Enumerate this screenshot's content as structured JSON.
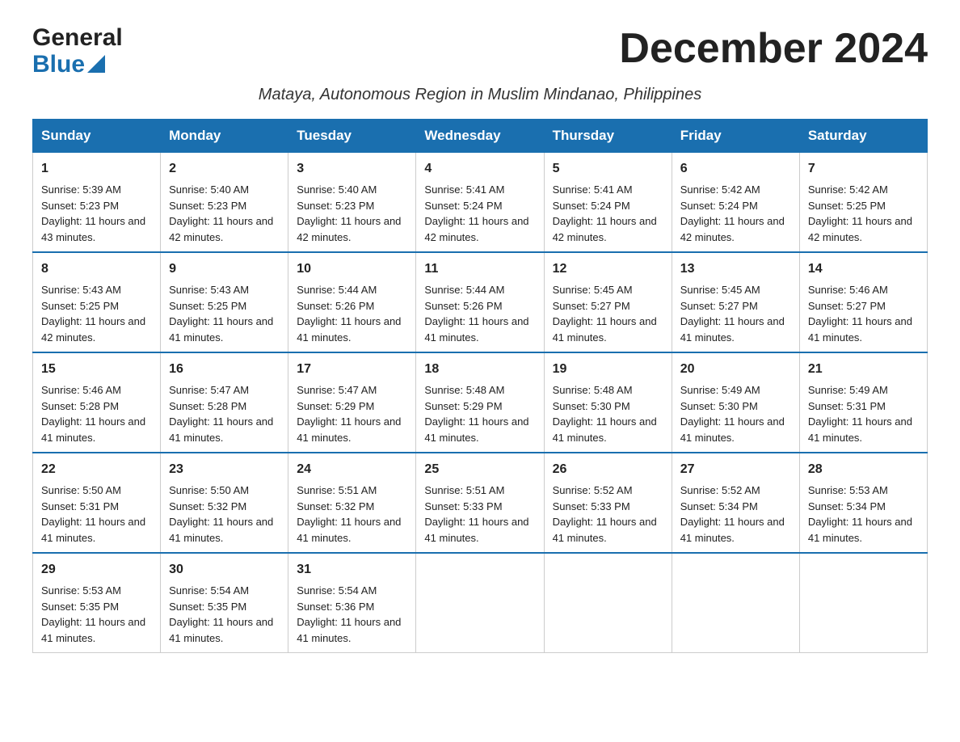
{
  "header": {
    "logo_general": "General",
    "logo_blue": "Blue",
    "month_title": "December 2024",
    "subtitle": "Mataya, Autonomous Region in Muslim Mindanao, Philippines"
  },
  "calendar": {
    "days_of_week": [
      "Sunday",
      "Monday",
      "Tuesday",
      "Wednesday",
      "Thursday",
      "Friday",
      "Saturday"
    ],
    "weeks": [
      [
        {
          "day": "1",
          "sunrise": "Sunrise: 5:39 AM",
          "sunset": "Sunset: 5:23 PM",
          "daylight": "Daylight: 11 hours and 43 minutes."
        },
        {
          "day": "2",
          "sunrise": "Sunrise: 5:40 AM",
          "sunset": "Sunset: 5:23 PM",
          "daylight": "Daylight: 11 hours and 42 minutes."
        },
        {
          "day": "3",
          "sunrise": "Sunrise: 5:40 AM",
          "sunset": "Sunset: 5:23 PM",
          "daylight": "Daylight: 11 hours and 42 minutes."
        },
        {
          "day": "4",
          "sunrise": "Sunrise: 5:41 AM",
          "sunset": "Sunset: 5:24 PM",
          "daylight": "Daylight: 11 hours and 42 minutes."
        },
        {
          "day": "5",
          "sunrise": "Sunrise: 5:41 AM",
          "sunset": "Sunset: 5:24 PM",
          "daylight": "Daylight: 11 hours and 42 minutes."
        },
        {
          "day": "6",
          "sunrise": "Sunrise: 5:42 AM",
          "sunset": "Sunset: 5:24 PM",
          "daylight": "Daylight: 11 hours and 42 minutes."
        },
        {
          "day": "7",
          "sunrise": "Sunrise: 5:42 AM",
          "sunset": "Sunset: 5:25 PM",
          "daylight": "Daylight: 11 hours and 42 minutes."
        }
      ],
      [
        {
          "day": "8",
          "sunrise": "Sunrise: 5:43 AM",
          "sunset": "Sunset: 5:25 PM",
          "daylight": "Daylight: 11 hours and 42 minutes."
        },
        {
          "day": "9",
          "sunrise": "Sunrise: 5:43 AM",
          "sunset": "Sunset: 5:25 PM",
          "daylight": "Daylight: 11 hours and 41 minutes."
        },
        {
          "day": "10",
          "sunrise": "Sunrise: 5:44 AM",
          "sunset": "Sunset: 5:26 PM",
          "daylight": "Daylight: 11 hours and 41 minutes."
        },
        {
          "day": "11",
          "sunrise": "Sunrise: 5:44 AM",
          "sunset": "Sunset: 5:26 PM",
          "daylight": "Daylight: 11 hours and 41 minutes."
        },
        {
          "day": "12",
          "sunrise": "Sunrise: 5:45 AM",
          "sunset": "Sunset: 5:27 PM",
          "daylight": "Daylight: 11 hours and 41 minutes."
        },
        {
          "day": "13",
          "sunrise": "Sunrise: 5:45 AM",
          "sunset": "Sunset: 5:27 PM",
          "daylight": "Daylight: 11 hours and 41 minutes."
        },
        {
          "day": "14",
          "sunrise": "Sunrise: 5:46 AM",
          "sunset": "Sunset: 5:27 PM",
          "daylight": "Daylight: 11 hours and 41 minutes."
        }
      ],
      [
        {
          "day": "15",
          "sunrise": "Sunrise: 5:46 AM",
          "sunset": "Sunset: 5:28 PM",
          "daylight": "Daylight: 11 hours and 41 minutes."
        },
        {
          "day": "16",
          "sunrise": "Sunrise: 5:47 AM",
          "sunset": "Sunset: 5:28 PM",
          "daylight": "Daylight: 11 hours and 41 minutes."
        },
        {
          "day": "17",
          "sunrise": "Sunrise: 5:47 AM",
          "sunset": "Sunset: 5:29 PM",
          "daylight": "Daylight: 11 hours and 41 minutes."
        },
        {
          "day": "18",
          "sunrise": "Sunrise: 5:48 AM",
          "sunset": "Sunset: 5:29 PM",
          "daylight": "Daylight: 11 hours and 41 minutes."
        },
        {
          "day": "19",
          "sunrise": "Sunrise: 5:48 AM",
          "sunset": "Sunset: 5:30 PM",
          "daylight": "Daylight: 11 hours and 41 minutes."
        },
        {
          "day": "20",
          "sunrise": "Sunrise: 5:49 AM",
          "sunset": "Sunset: 5:30 PM",
          "daylight": "Daylight: 11 hours and 41 minutes."
        },
        {
          "day": "21",
          "sunrise": "Sunrise: 5:49 AM",
          "sunset": "Sunset: 5:31 PM",
          "daylight": "Daylight: 11 hours and 41 minutes."
        }
      ],
      [
        {
          "day": "22",
          "sunrise": "Sunrise: 5:50 AM",
          "sunset": "Sunset: 5:31 PM",
          "daylight": "Daylight: 11 hours and 41 minutes."
        },
        {
          "day": "23",
          "sunrise": "Sunrise: 5:50 AM",
          "sunset": "Sunset: 5:32 PM",
          "daylight": "Daylight: 11 hours and 41 minutes."
        },
        {
          "day": "24",
          "sunrise": "Sunrise: 5:51 AM",
          "sunset": "Sunset: 5:32 PM",
          "daylight": "Daylight: 11 hours and 41 minutes."
        },
        {
          "day": "25",
          "sunrise": "Sunrise: 5:51 AM",
          "sunset": "Sunset: 5:33 PM",
          "daylight": "Daylight: 11 hours and 41 minutes."
        },
        {
          "day": "26",
          "sunrise": "Sunrise: 5:52 AM",
          "sunset": "Sunset: 5:33 PM",
          "daylight": "Daylight: 11 hours and 41 minutes."
        },
        {
          "day": "27",
          "sunrise": "Sunrise: 5:52 AM",
          "sunset": "Sunset: 5:34 PM",
          "daylight": "Daylight: 11 hours and 41 minutes."
        },
        {
          "day": "28",
          "sunrise": "Sunrise: 5:53 AM",
          "sunset": "Sunset: 5:34 PM",
          "daylight": "Daylight: 11 hours and 41 minutes."
        }
      ],
      [
        {
          "day": "29",
          "sunrise": "Sunrise: 5:53 AM",
          "sunset": "Sunset: 5:35 PM",
          "daylight": "Daylight: 11 hours and 41 minutes."
        },
        {
          "day": "30",
          "sunrise": "Sunrise: 5:54 AM",
          "sunset": "Sunset: 5:35 PM",
          "daylight": "Daylight: 11 hours and 41 minutes."
        },
        {
          "day": "31",
          "sunrise": "Sunrise: 5:54 AM",
          "sunset": "Sunset: 5:36 PM",
          "daylight": "Daylight: 11 hours and 41 minutes."
        },
        null,
        null,
        null,
        null
      ]
    ]
  }
}
